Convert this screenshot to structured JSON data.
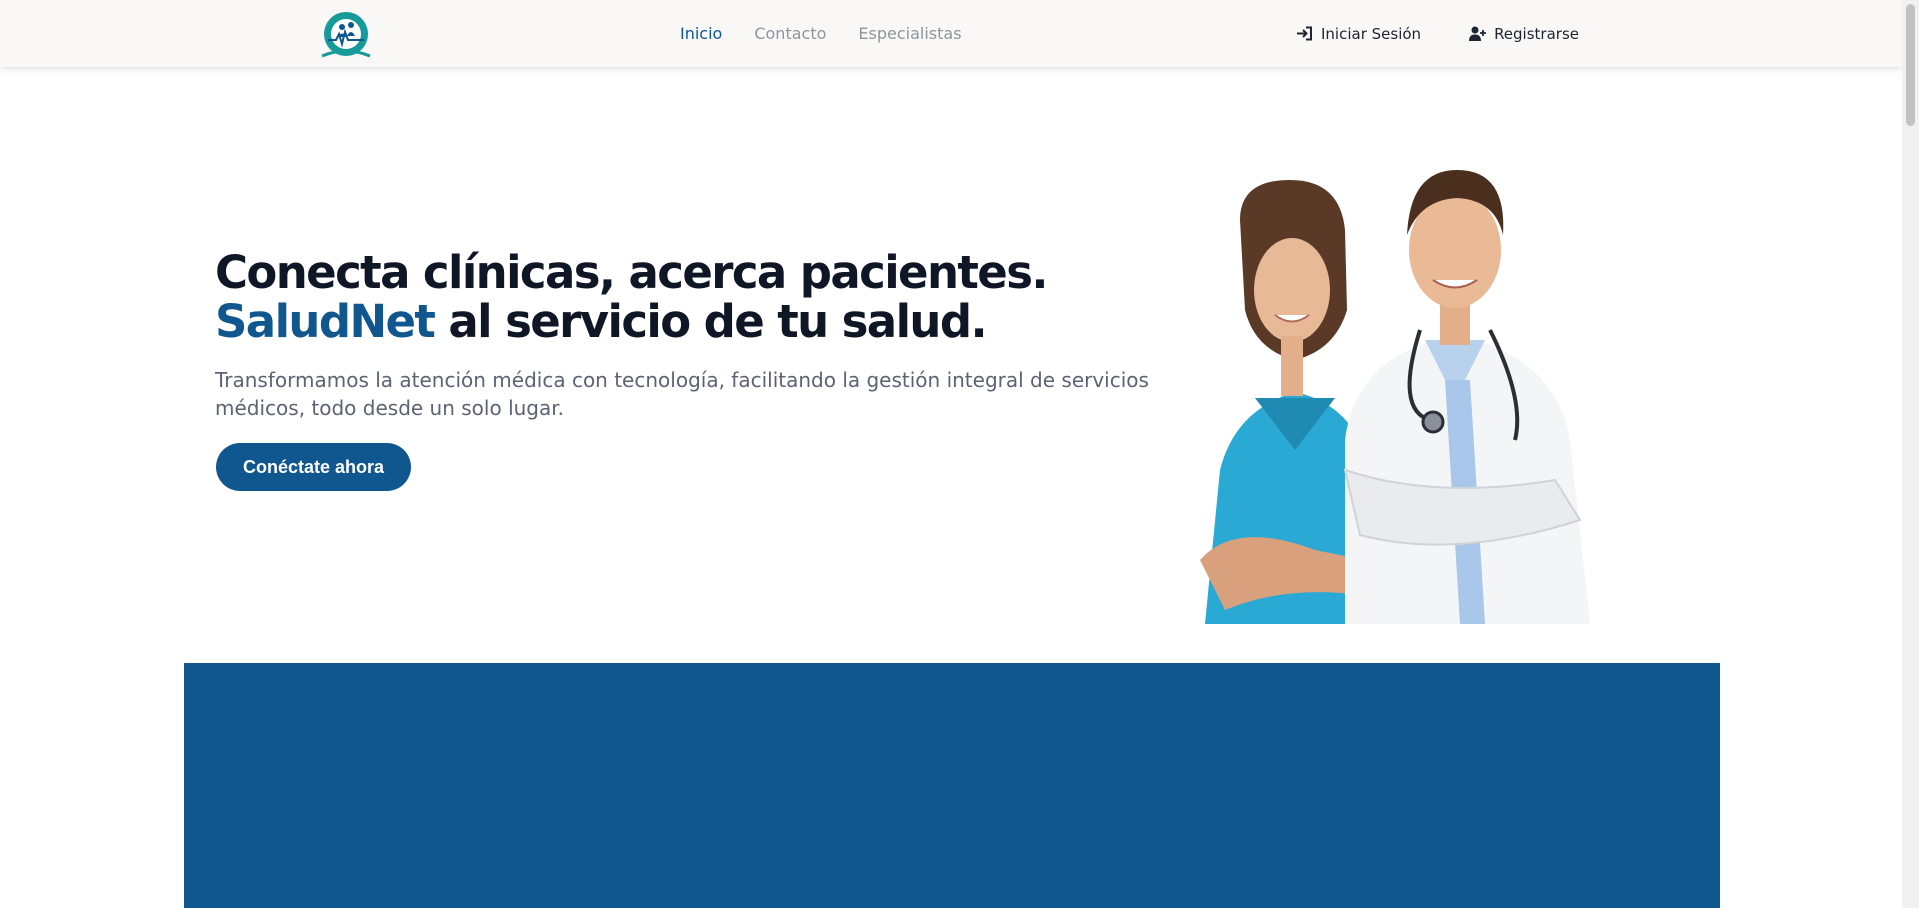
{
  "header": {
    "logo_icon": "saludnet-logo-icon",
    "nav": [
      {
        "label": "Inicio",
        "active": true
      },
      {
        "label": "Contacto",
        "active": false
      },
      {
        "label": "Especialistas",
        "active": false
      }
    ],
    "login": {
      "label": "Iniciar Sesión",
      "icon": "sign-in-icon"
    },
    "register": {
      "label": "Registrarse",
      "icon": "user-plus-icon"
    }
  },
  "hero": {
    "title_line1": "Conecta clínicas, acerca pacientes.",
    "title_brand": "SaludNet",
    "title_line2_rest": " al servicio de tu salud.",
    "subtitle": "Transformamos la atención médica con tecnología, facilitando la gestión integral de servicios médicos, todo desde un solo lugar.",
    "cta_label": "Conéctate ahora",
    "image_icon": "doctors-image"
  },
  "colors": {
    "brand_blue": "#10578f",
    "teal": "#179a9a",
    "dark_text": "#0f1626",
    "muted_text": "#8f959c",
    "header_bg": "#f9f8f7"
  }
}
